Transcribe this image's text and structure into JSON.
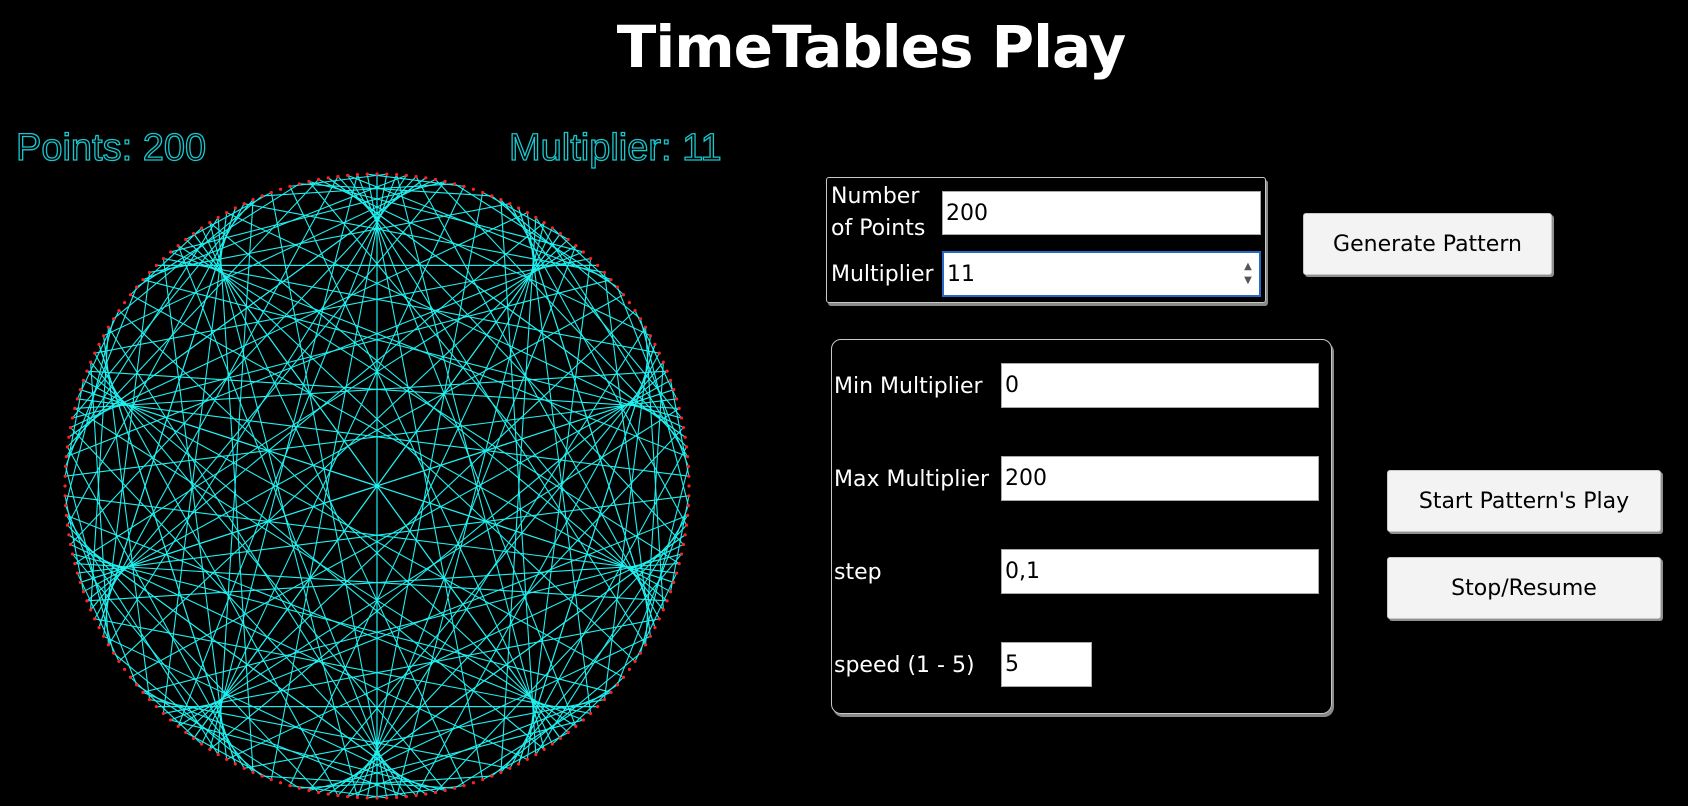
{
  "window": {
    "title": "TimeTables Play"
  },
  "canvas": {
    "points_label": "Points: 200",
    "multiplier_label": "Multiplier: 11",
    "points": 200,
    "multiplier": 11,
    "line_color": "#20f0f0",
    "point_color": "#ff2020",
    "label_color": "#19c7cf"
  },
  "pattern_panel": {
    "points_label": "Number of Points",
    "points_value": "200",
    "multiplier_label": "Multiplier",
    "multiplier_value": "11",
    "generate_button": "Generate Pattern"
  },
  "play_panel": {
    "min_label": "Min Multiplier",
    "min_value": "0",
    "max_label": "Max Multiplier",
    "max_value": "200",
    "step_label": "step",
    "step_value": "0,1",
    "speed_label": "speed (1 - 5)",
    "speed_value": "5",
    "start_button": "Start Pattern's Play",
    "stop_button": "Stop/Resume"
  }
}
